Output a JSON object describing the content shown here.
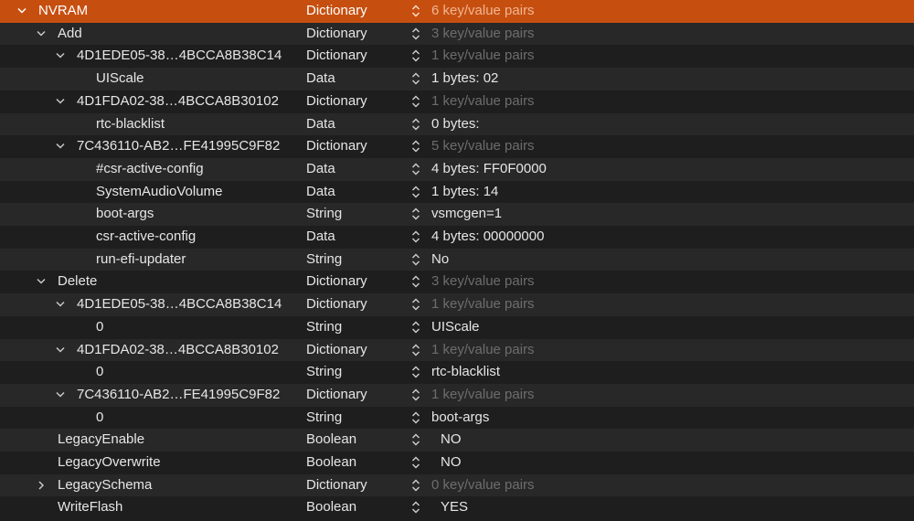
{
  "rows": [
    {
      "key": "NVRAM",
      "type": "Dictionary",
      "value": "6 key/value pairs",
      "depth": 0,
      "disclosure": "expanded",
      "muted": true,
      "selected": true
    },
    {
      "key": "Add",
      "type": "Dictionary",
      "value": "3 key/value pairs",
      "depth": 1,
      "disclosure": "expanded",
      "muted": true
    },
    {
      "key": "4D1EDE05-38…4BCCA8B38C14",
      "type": "Dictionary",
      "value": "1 key/value pairs",
      "depth": 2,
      "disclosure": "expanded",
      "muted": true
    },
    {
      "key": "UIScale",
      "type": "Data",
      "value": "1 bytes: 02",
      "depth": 3,
      "disclosure": "none"
    },
    {
      "key": "4D1FDA02-38…4BCCA8B30102",
      "type": "Dictionary",
      "value": "1 key/value pairs",
      "depth": 2,
      "disclosure": "expanded",
      "muted": true
    },
    {
      "key": "rtc-blacklist",
      "type": "Data",
      "value": "0 bytes:",
      "depth": 3,
      "disclosure": "none"
    },
    {
      "key": "7C436110-AB2…FE41995C9F82",
      "type": "Dictionary",
      "value": "5 key/value pairs",
      "depth": 2,
      "disclosure": "expanded",
      "muted": true
    },
    {
      "key": "#csr-active-config",
      "type": "Data",
      "value": "4 bytes: FF0F0000",
      "depth": 3,
      "disclosure": "none"
    },
    {
      "key": "SystemAudioVolume",
      "type": "Data",
      "value": "1 bytes: 14",
      "depth": 3,
      "disclosure": "none"
    },
    {
      "key": "boot-args",
      "type": "String",
      "value": "vsmcgen=1",
      "depth": 3,
      "disclosure": "none"
    },
    {
      "key": "csr-active-config",
      "type": "Data",
      "value": "4 bytes: 00000000",
      "depth": 3,
      "disclosure": "none"
    },
    {
      "key": "run-efi-updater",
      "type": "String",
      "value": "No",
      "depth": 3,
      "disclosure": "none"
    },
    {
      "key": "Delete",
      "type": "Dictionary",
      "value": "3 key/value pairs",
      "depth": 1,
      "disclosure": "expanded",
      "muted": true
    },
    {
      "key": "4D1EDE05-38…4BCCA8B38C14",
      "type": "Dictionary",
      "value": "1 key/value pairs",
      "depth": 2,
      "disclosure": "expanded",
      "muted": true
    },
    {
      "key": "0",
      "type": "String",
      "value": "UIScale",
      "depth": 3,
      "disclosure": "none"
    },
    {
      "key": "4D1FDA02-38…4BCCA8B30102",
      "type": "Dictionary",
      "value": "1 key/value pairs",
      "depth": 2,
      "disclosure": "expanded",
      "muted": true
    },
    {
      "key": "0",
      "type": "String",
      "value": "rtc-blacklist",
      "depth": 3,
      "disclosure": "none"
    },
    {
      "key": "7C436110-AB2…FE41995C9F82",
      "type": "Dictionary",
      "value": "1 key/value pairs",
      "depth": 2,
      "disclosure": "expanded",
      "muted": true
    },
    {
      "key": "0",
      "type": "String",
      "value": "boot-args",
      "depth": 3,
      "disclosure": "none"
    },
    {
      "key": "LegacyEnable",
      "type": "Boolean",
      "value": "NO",
      "depth": 1,
      "disclosure": "none",
      "boolean": true
    },
    {
      "key": "LegacyOverwrite",
      "type": "Boolean",
      "value": "NO",
      "depth": 1,
      "disclosure": "none",
      "boolean": true
    },
    {
      "key": "LegacySchema",
      "type": "Dictionary",
      "value": "0 key/value pairs",
      "depth": 1,
      "disclosure": "collapsed",
      "muted": true
    },
    {
      "key": "WriteFlash",
      "type": "Boolean",
      "value": "YES",
      "depth": 1,
      "disclosure": "none",
      "boolean": true
    }
  ]
}
